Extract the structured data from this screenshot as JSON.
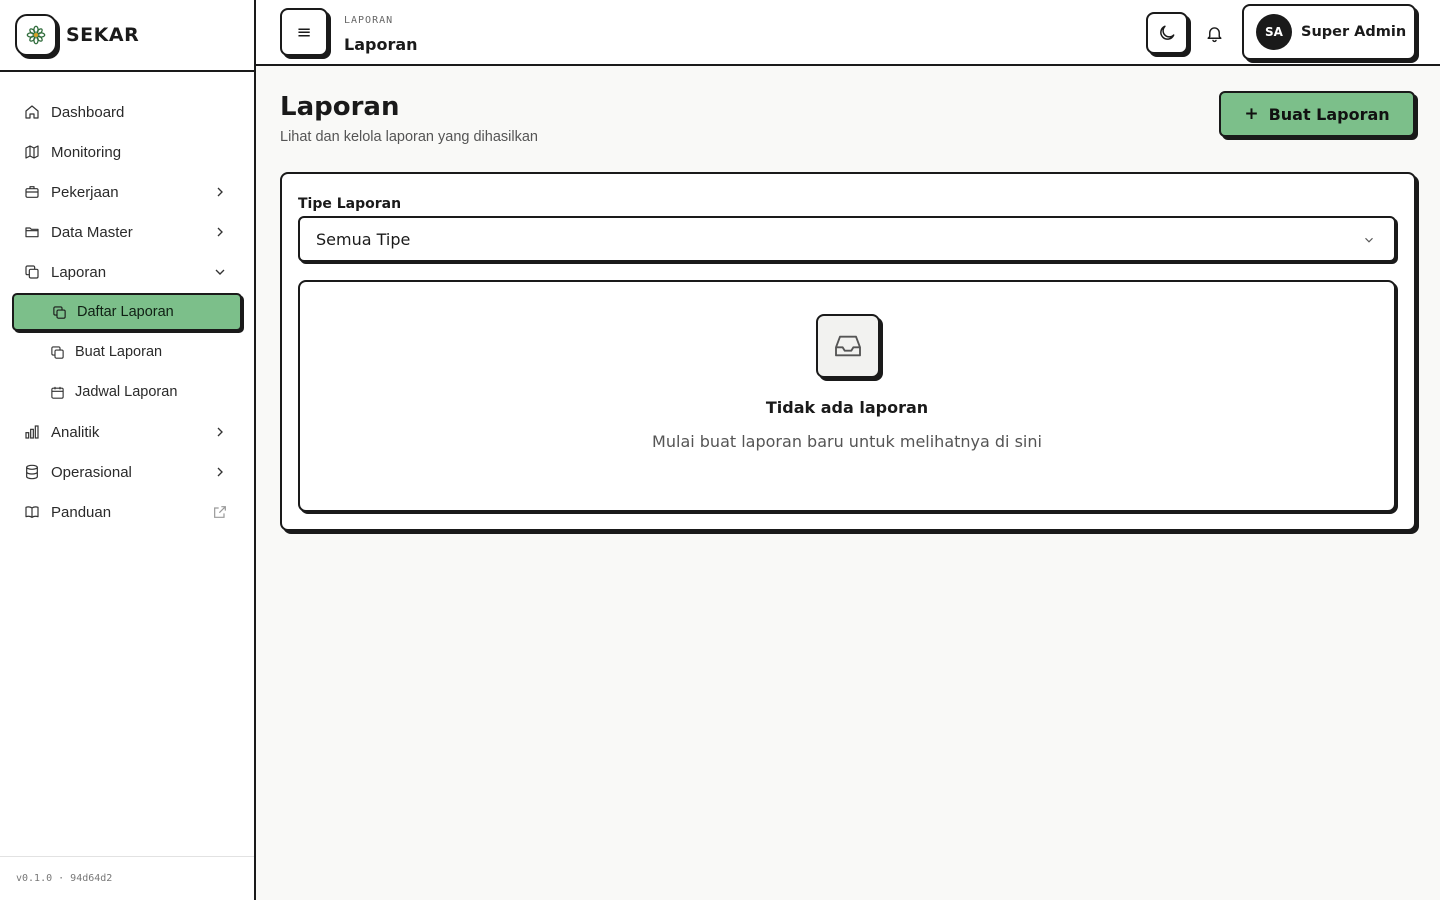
{
  "brand": {
    "name": "SEKAR",
    "logo_icon": "flower-icon"
  },
  "sidebar": {
    "items": [
      {
        "label": "Dashboard",
        "icon": "home-icon"
      },
      {
        "label": "Monitoring",
        "icon": "map-icon"
      },
      {
        "label": "Pekerjaan",
        "icon": "briefcase-icon",
        "expanded": false
      },
      {
        "label": "Data Master",
        "icon": "folder-icon",
        "expanded": false
      },
      {
        "label": "Laporan",
        "icon": "copy-icon",
        "expanded": true
      },
      {
        "label": "Analitik",
        "icon": "bar-chart-icon",
        "expanded": false
      },
      {
        "label": "Operasional",
        "icon": "database-icon",
        "expanded": false
      },
      {
        "label": "Panduan",
        "icon": "book-icon",
        "external": true
      }
    ],
    "laporan_sub": [
      {
        "label": "Daftar Laporan",
        "icon": "copy-icon",
        "active": true
      },
      {
        "label": "Buat Laporan",
        "icon": "copy-icon",
        "active": false
      },
      {
        "label": "Jadwal Laporan",
        "icon": "calendar-icon",
        "active": false
      }
    ],
    "version": "v0.1.0 · 94d64d2"
  },
  "topbar": {
    "section": "LAPORAN",
    "title": "Laporan",
    "user": {
      "initials": "SA",
      "name": "Super Admin"
    }
  },
  "main": {
    "title": "Laporan",
    "subtitle": "Lihat dan kelola laporan yang dihasilkan",
    "create_button": "Buat Laporan",
    "filter": {
      "label": "Tipe Laporan",
      "value": "Semua Tipe"
    },
    "empty": {
      "title": "Tidak ada laporan",
      "message": "Mulai buat laporan baru untuk melihatnya di sini"
    }
  },
  "colors": {
    "accent": "#7cbf8a",
    "border": "#1a1a1a",
    "background": "#f9f9f7"
  }
}
